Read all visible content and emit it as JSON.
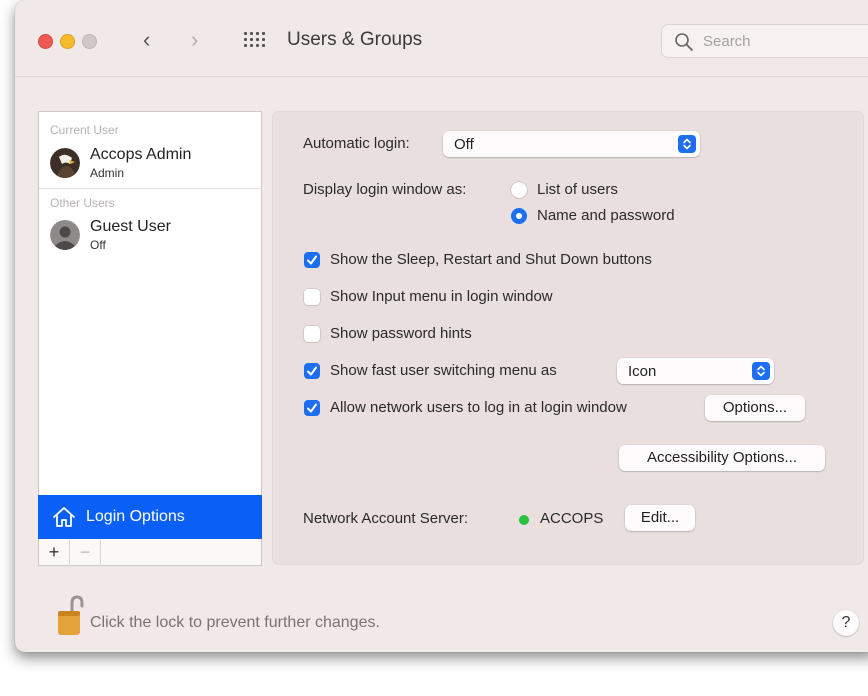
{
  "window": {
    "title": "Users & Groups",
    "search_placeholder": "Search"
  },
  "sidebar": {
    "current_user_header": "Current User",
    "other_users_header": "Other Users",
    "users": [
      {
        "name": "Accops Admin",
        "role": "Admin"
      },
      {
        "name": "Guest User",
        "role": "Off"
      }
    ],
    "login_options_label": "Login Options",
    "add_label": "+",
    "remove_label": "−"
  },
  "login": {
    "automatic_login_label": "Automatic login:",
    "automatic_login_value": "Off",
    "display_as_label": "Display login window as:",
    "display_options": [
      {
        "label": "List of users",
        "selected": false
      },
      {
        "label": "Name and password",
        "selected": true
      }
    ],
    "checkboxes": [
      {
        "label": "Show the Sleep, Restart and Shut Down buttons",
        "checked": true
      },
      {
        "label": "Show Input menu in login window",
        "checked": false
      },
      {
        "label": "Show password hints",
        "checked": false
      },
      {
        "label": "Show fast user switching menu as",
        "checked": true
      },
      {
        "label": "Allow network users to log in at login window",
        "checked": true
      }
    ],
    "fast_switch_value": "Icon",
    "options_button": "Options...",
    "accessibility_button": "Accessibility Options...",
    "network_server_label": "Network Account Server:",
    "network_server_value": "ACCOPS",
    "network_status_color": "#29c23e",
    "edit_button": "Edit..."
  },
  "footer": {
    "lock_text": "Click the lock to prevent further changes.",
    "help_label": "?"
  },
  "colors": {
    "accent": "#0a60f6",
    "window_bg": "#f1e9e8"
  }
}
